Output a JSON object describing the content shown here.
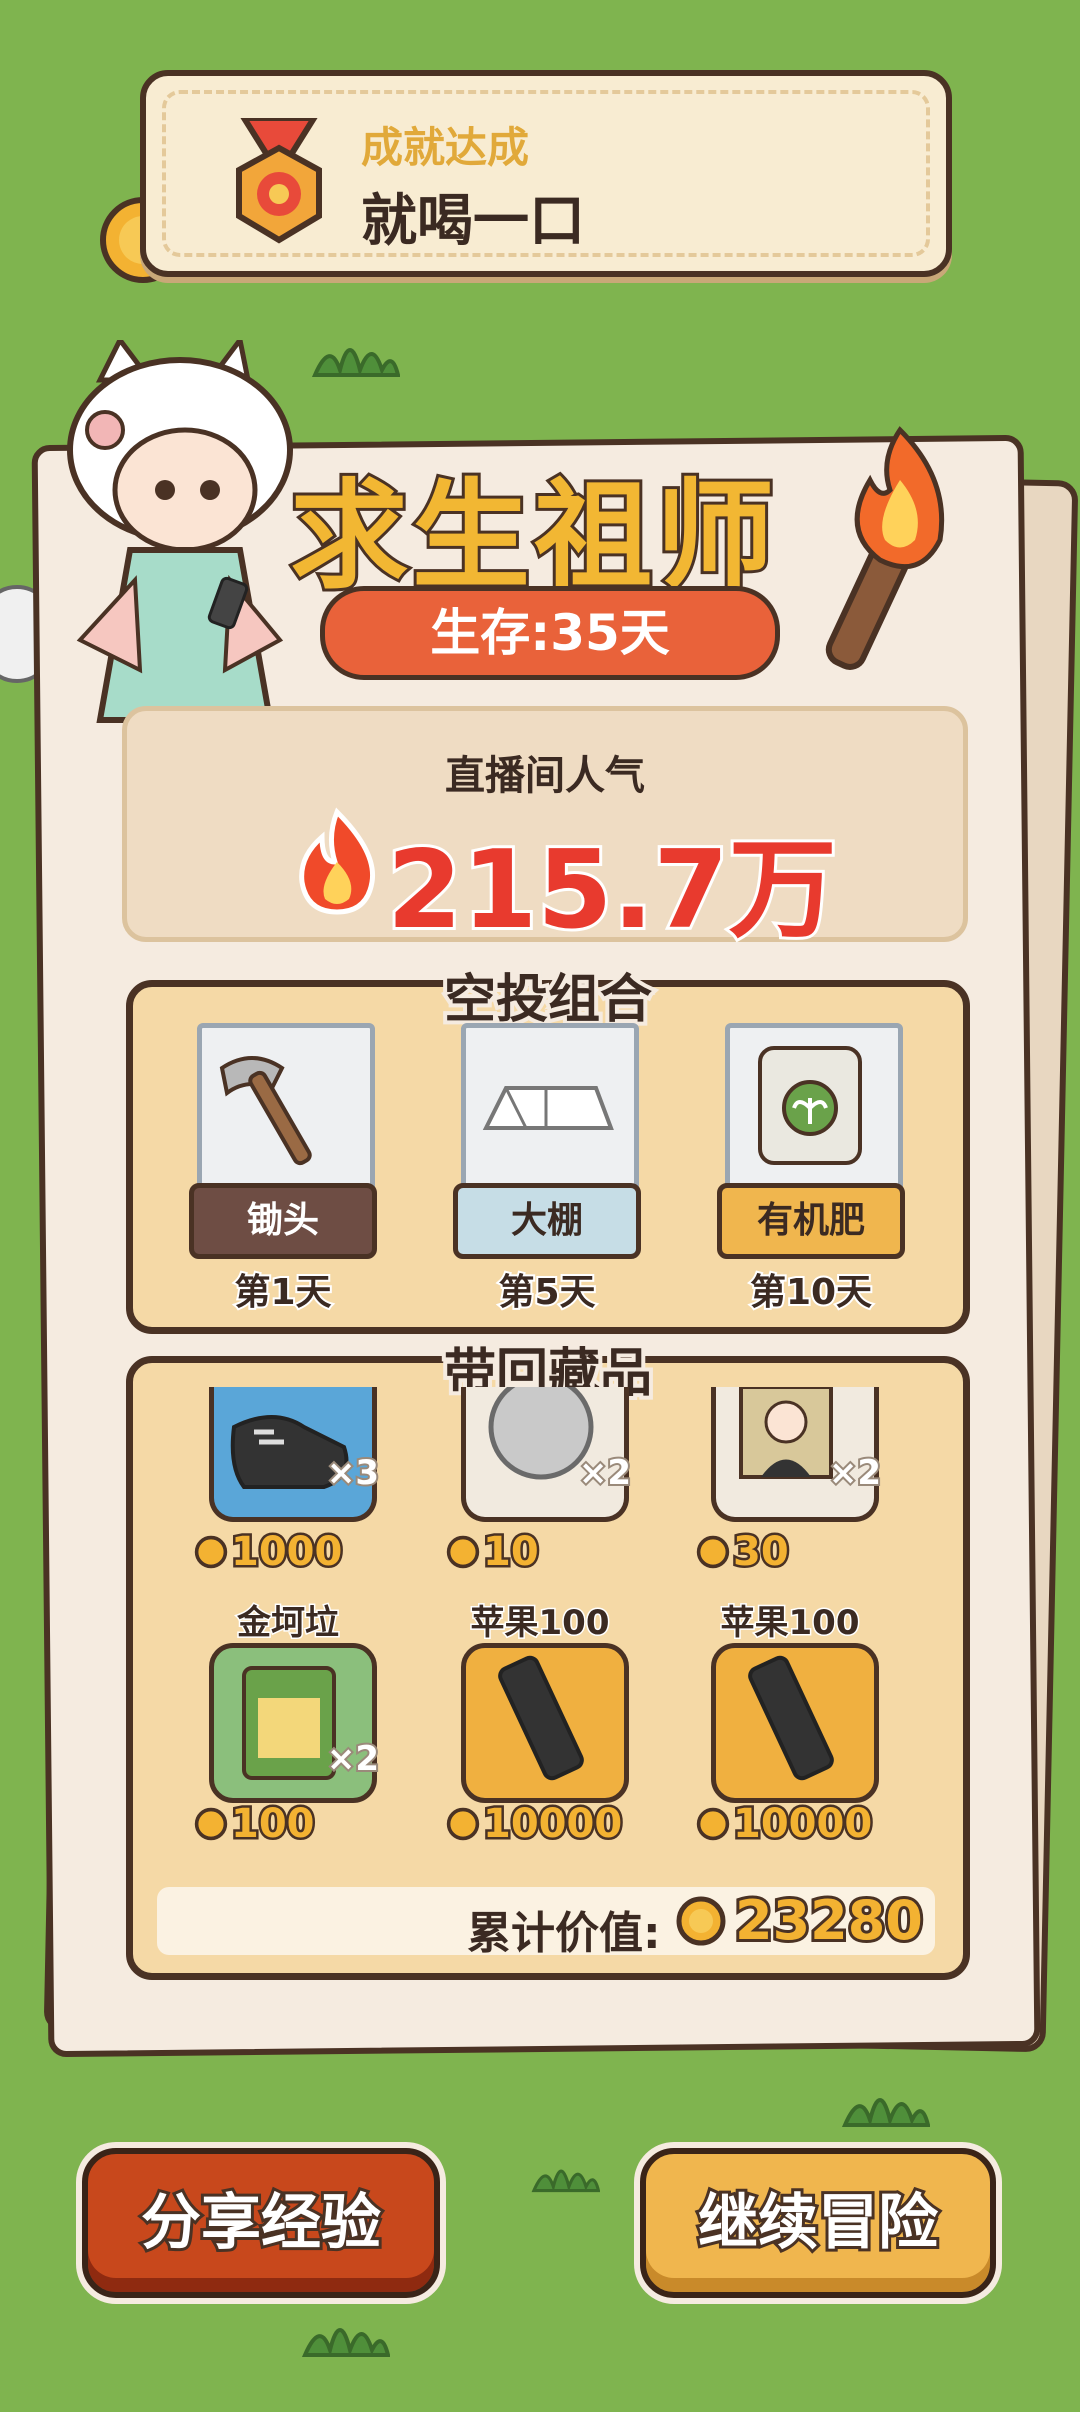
{
  "achievement": {
    "label": "成就达成",
    "name": "就喝一口"
  },
  "title": "求生祖师",
  "survival": "生存:35天",
  "popularity": {
    "label": "直播间人气",
    "value": "215.7万"
  },
  "airdrop": {
    "title": "空投组合",
    "items": [
      {
        "name": "锄头",
        "day": "第1天",
        "tag_color": "#6e4d44",
        "tag_text_color": "#ffffff",
        "icon": "hoe-icon"
      },
      {
        "name": "大棚",
        "day": "第5天",
        "tag_color": "#c6dde6",
        "tag_text_color": "#3b2a22",
        "icon": "tent-icon"
      },
      {
        "name": "有机肥",
        "day": "第10天",
        "tag_color": "#f0b64e",
        "tag_text_color": "#3b2a22",
        "icon": "fertilizer-bag-icon"
      }
    ]
  },
  "collection": {
    "title": "带回藏品",
    "items": [
      {
        "name": "",
        "qty": "×3",
        "price": "1000",
        "bg": "#5aa6d8",
        "icon": "sneaker-icon"
      },
      {
        "name": "",
        "qty": "×2",
        "price": "10",
        "bg": "#f1eadf",
        "icon": "silver-coin-icon"
      },
      {
        "name": "",
        "qty": "×2",
        "price": "30",
        "bg": "#f1eadf",
        "icon": "portrait-photo-icon"
      },
      {
        "name": "金坷垃",
        "qty": "×2",
        "price": "100",
        "bg": "#8bbf7c",
        "icon": "fertilizer-pack-icon"
      },
      {
        "name": "苹果100",
        "qty": "",
        "price": "10000",
        "bg": "#f0b040",
        "icon": "phone-icon"
      },
      {
        "name": "苹果100",
        "qty": "",
        "price": "10000",
        "bg": "#f0b040",
        "icon": "phone-icon"
      }
    ],
    "total_label": "累计价值:",
    "total_value": "23280"
  },
  "buttons": {
    "share": "分享经验",
    "continue": "继续冒险"
  }
}
